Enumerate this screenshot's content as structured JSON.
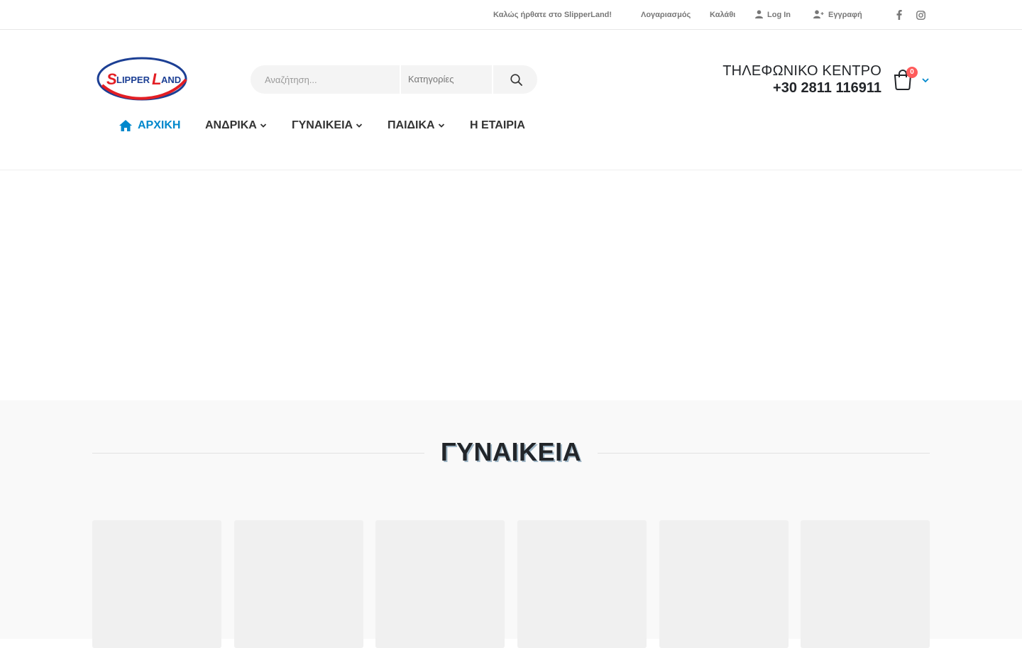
{
  "topbar": {
    "welcome": "Καλώς ήρθατε στο SlipperLand!",
    "account": "Λογαριασμός",
    "cart": "Καλάθι",
    "login": "Log In",
    "register": "Εγγραφή",
    "social": [
      "facebook-icon",
      "instagram-icon"
    ]
  },
  "header": {
    "logo_text": "SLIPPERLAND",
    "search_placeholder": "Αναζήτηση...",
    "search_category": "Κατηγορίες",
    "phone_label": "ΤΗΛΕΦΩΝΙΚΟ ΚΕΝΤΡΟ",
    "phone_number": "+30 2811 116911",
    "cart_count": "0"
  },
  "nav": {
    "items": [
      {
        "label": "ΑΡΧΙΚΗ",
        "active": true
      },
      {
        "label": "ΑΝΔΡΙΚΑ",
        "dropdown": true
      },
      {
        "label": "ΓΥΝΑΙΚΕΙΑ",
        "dropdown": true
      },
      {
        "label": "ΠΑΙΔΙΚΑ",
        "dropdown": true
      },
      {
        "label": "Η ΕΤΑΙΡΙΑ"
      }
    ]
  },
  "section": {
    "title": "ΓΥΝΑΙΚΕΙΑ"
  },
  "colors": {
    "accent": "#0088cc",
    "badge": "#ff5b5b",
    "logo_red": "#e31e24",
    "logo_blue": "#1c3f94"
  }
}
